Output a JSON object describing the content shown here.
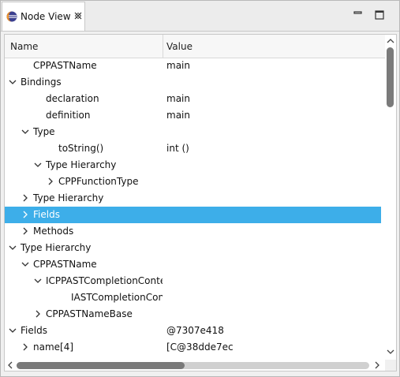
{
  "tab": {
    "title": "Node View",
    "icon": "eclipse-icon"
  },
  "window": {
    "minimize_icon": "minimize-icon",
    "maximize_icon": "maximize-icon"
  },
  "columns": {
    "name": "Name",
    "value": "Value"
  },
  "rows": [
    {
      "name": "CPPASTName",
      "value": "main",
      "depth": 1,
      "arrow": "none"
    },
    {
      "name": "Bindings",
      "value": "",
      "depth": 0,
      "arrow": "down"
    },
    {
      "name": "declaration",
      "value": "main",
      "depth": 2,
      "arrow": "none"
    },
    {
      "name": "definition",
      "value": "main",
      "depth": 2,
      "arrow": "none"
    },
    {
      "name": "Type",
      "value": "",
      "depth": 1,
      "arrow": "down"
    },
    {
      "name": "toString()",
      "value": "int ()",
      "depth": 3,
      "arrow": "none"
    },
    {
      "name": "Type Hierarchy",
      "value": "",
      "depth": 2,
      "arrow": "down"
    },
    {
      "name": "CPPFunctionType",
      "value": "",
      "depth": 3,
      "arrow": "right"
    },
    {
      "name": "Type Hierarchy",
      "value": "",
      "depth": 1,
      "arrow": "right"
    },
    {
      "name": "Fields",
      "value": "",
      "depth": 1,
      "arrow": "right",
      "selected": true
    },
    {
      "name": "Methods",
      "value": "",
      "depth": 1,
      "arrow": "right"
    },
    {
      "name": "Type Hierarchy",
      "value": "",
      "depth": 0,
      "arrow": "down"
    },
    {
      "name": "CPPASTName",
      "value": "",
      "depth": 1,
      "arrow": "down"
    },
    {
      "name": "ICPPASTCompletionContext",
      "value": "",
      "depth": 2,
      "arrow": "down"
    },
    {
      "name": "IASTCompletionContext",
      "value": "",
      "depth": 4,
      "arrow": "none"
    },
    {
      "name": "CPPASTNameBase",
      "value": "",
      "depth": 2,
      "arrow": "right"
    },
    {
      "name": "Fields",
      "value": "@7307e418",
      "depth": 0,
      "arrow": "down"
    },
    {
      "name": "name[4]",
      "value": "[C@38dde7ec",
      "depth": 1,
      "arrow": "right"
    }
  ]
}
